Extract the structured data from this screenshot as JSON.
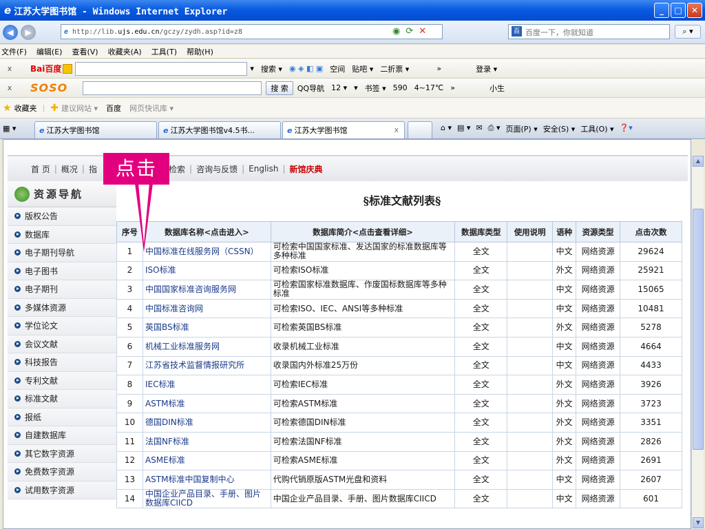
{
  "window": {
    "title": "江苏大学图书馆 - Windows Internet Explorer"
  },
  "address": {
    "url_prefix": "http://lib.",
    "url_host": "ujs.edu.cn",
    "url_suffix": "/gczy/zydh.asp?id=z8",
    "search_placeholder": "百度一下，你就知道"
  },
  "menu": [
    "文件(F)",
    "编辑(E)",
    "查看(V)",
    "收藏夹(A)",
    "工具(T)",
    "帮助(H)"
  ],
  "toolbar1": {
    "close": "x",
    "logo_a": "Bai",
    "logo_b": "百度",
    "items": [
      "搜索 ▾",
      "空间",
      "贴吧 ▾",
      "二折票 ▾",
      "»",
      "登录 ▾"
    ]
  },
  "toolbar2": {
    "close": "x",
    "logo_a": "SO",
    "logo_b": "SO",
    "search_btn": "搜 索",
    "items": [
      "QQ导航",
      "12 ▾",
      "▾",
      "书签 ▾",
      "590",
      "4~17℃",
      "»",
      "小生"
    ]
  },
  "favorites": {
    "label": "收藏夹",
    "items": [
      "建议网站 ▾",
      "百度",
      "网页快讯库 ▾"
    ]
  },
  "tabs": [
    {
      "label": "江苏大学图书馆"
    },
    {
      "label": "江苏大学图书馆v4.5书..."
    },
    {
      "label": "江苏大学图书馆",
      "close": "x"
    }
  ],
  "tabtools": [
    "页面(P) ▾",
    "安全(S) ▾",
    "工具(O) ▾"
  ],
  "topnav": {
    "items": [
      "首 页",
      "概况",
      "指",
      "导",
      "检索",
      "咨询与反馈",
      "English"
    ],
    "highlight": "新馆庆典"
  },
  "sidebar": {
    "title": "资源导航",
    "items": [
      "版权公告",
      "数据库",
      "电子期刊导航",
      "电子图书",
      "电子期刊",
      "多媒体资源",
      "学位论文",
      "会议文献",
      "科技报告",
      "专利文献",
      "标准文献",
      "报纸",
      "自建数据库",
      "其它数字资源",
      "免费数字资源",
      "试用数字资源"
    ]
  },
  "page": {
    "title": "§标准文献列表§"
  },
  "annotation": {
    "label": "点击"
  },
  "table": {
    "headers": [
      "序号",
      "数据库名称<点击进入>",
      "数据库简介<点击查看详细>",
      "数据库类型",
      "使用说明",
      "语种",
      "资源类型",
      "点击次数"
    ],
    "rows": [
      [
        "1",
        "中国标准在线服务网（CSSN）",
        "可检索中国国家标准、发达国家的标准数据库等多种标准",
        "全文",
        "",
        "中文",
        "网络资源",
        "29624"
      ],
      [
        "2",
        "ISO标准",
        "可检索ISO标准",
        "全文",
        "",
        "外文",
        "网络资源",
        "25921"
      ],
      [
        "3",
        "中国国家标准咨询服务网",
        "可检索国家标准数据库、作废国标数据库等多种标准",
        "全文",
        "",
        "中文",
        "网络资源",
        "15065"
      ],
      [
        "4",
        "中国标准咨询网",
        "可检索ISO、IEC、ANSI等多种标准",
        "全文",
        "",
        "中文",
        "网络资源",
        "10481"
      ],
      [
        "5",
        "英国BS标准",
        "可检索英国BS标准",
        "全文",
        "",
        "外文",
        "网络资源",
        "5278"
      ],
      [
        "6",
        "机械工业标准服务网",
        "收录机械工业标准",
        "全文",
        "",
        "中文",
        "网络资源",
        "4664"
      ],
      [
        "7",
        "江苏省技术监督情报研究所",
        "收录国内外标准25万份",
        "全文",
        "",
        "中文",
        "网络资源",
        "4433"
      ],
      [
        "8",
        "IEC标准",
        "可检索IEC标准",
        "全文",
        "",
        "外文",
        "网络资源",
        "3926"
      ],
      [
        "9",
        "ASTM标准",
        "可检索ASTM标准",
        "全文",
        "",
        "外文",
        "网络资源",
        "3723"
      ],
      [
        "10",
        "德国DIN标准",
        "可检索德国DIN标准",
        "全文",
        "",
        "外文",
        "网络资源",
        "3351"
      ],
      [
        "11",
        "法国NF标准",
        "可检索法国NF标准",
        "全文",
        "",
        "外文",
        "网络资源",
        "2826"
      ],
      [
        "12",
        "ASME标准",
        "可检索ASME标准",
        "全文",
        "",
        "外文",
        "网络资源",
        "2691"
      ],
      [
        "13",
        "ASTM标准中国复制中心",
        "代购代销原版ASTM光盘和资料",
        "全文",
        "",
        "中文",
        "网络资源",
        "2607"
      ],
      [
        "14",
        "中国企业产品目录、手册、图片数据库CIICD",
        "中国企业产品目录、手册、图片数据库CIICD",
        "全文",
        "",
        "中文",
        "网络资源",
        "601"
      ]
    ]
  },
  "colors": {
    "annotation": "#e3007f",
    "title_bar": "#0450d8",
    "highlight_link": "#cc0000"
  }
}
